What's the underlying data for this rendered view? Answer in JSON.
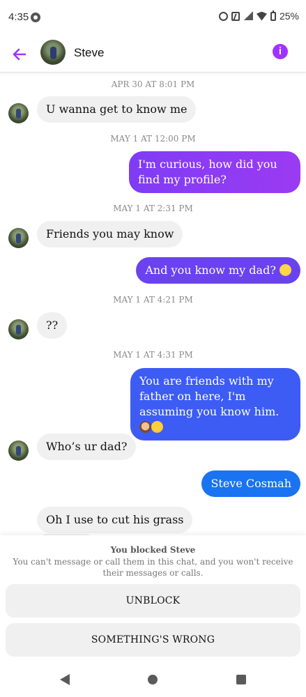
{
  "status_bar": {
    "time": "4:35",
    "battery": "25%",
    "icons": [
      "notification-icon",
      "alarm-icon",
      "nfc-icon",
      "signal-icon",
      "wifi-icon",
      "battery-icon"
    ]
  },
  "header": {
    "contact_name": "Steve",
    "accent_color": "#a033ff"
  },
  "messages": {
    "ts1": "APR 30 AT 8:01 PM",
    "m1": "U wanna get to know me",
    "ts2": "MAY 1 AT 12:00 PM",
    "m2": "I'm curious, how did you find my profile?",
    "ts3": "MAY 1 AT 2:31 PM",
    "m3": "Friends you may know",
    "m4": "And you know my dad?",
    "ts4": "MAY 1 AT 4:21 PM",
    "m5": "??",
    "ts5": "MAY 1 AT 4:31 PM",
    "m6": "You are friends with my father on here, I'm assuming you know him.",
    "m7": "Who’s ur dad?",
    "m8": "Steve Cosmah",
    "m9": "Oh I use to cut his grass"
  },
  "blocked_panel": {
    "title": "You blocked Steve",
    "description": "You can't message or call them in this chat, and you won't receive their messages or calls.",
    "unblock_label": "UNBLOCK",
    "wrong_label": "SOMETHING'S WRONG"
  },
  "colors": {
    "bubble_purple": "#8a3cf5",
    "bubble_indigo": "#6a43ee",
    "bubble_blue": "#3d5cf4",
    "bubble_sky": "#1a73f0",
    "incoming_bg": "#f0f0f0"
  }
}
